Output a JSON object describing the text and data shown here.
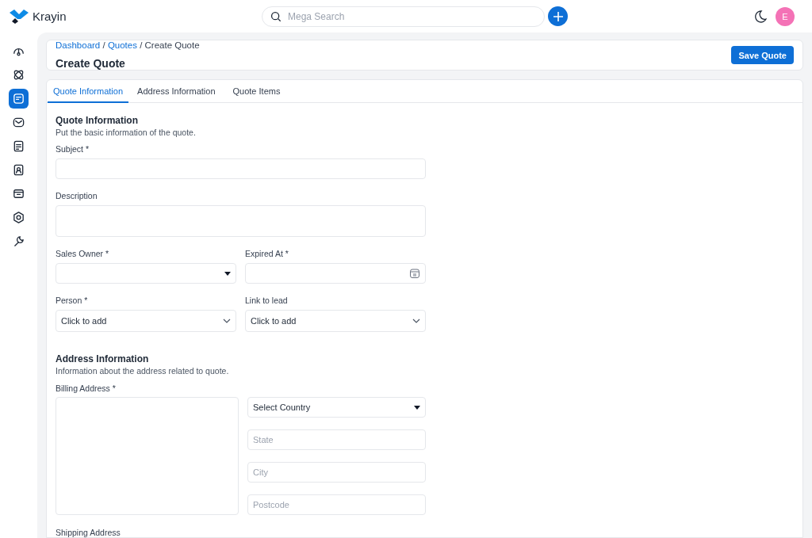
{
  "header": {
    "logo": "Krayin",
    "search": {
      "placeholder": "Mega Search"
    },
    "avatar": "E"
  },
  "sidebar": {
    "items": [
      {
        "selected": false
      },
      {
        "selected": false
      },
      {
        "selected": true
      },
      {
        "selected": false
      },
      {
        "selected": false
      },
      {
        "selected": false
      },
      {
        "selected": false
      },
      {
        "selected": false
      },
      {
        "selected": false
      }
    ]
  },
  "page": {
    "breadcrumb_separator": "/",
    "breadcrumb": [
      {
        "label": "Dashboard",
        "link": true
      },
      {
        "label": "Quotes",
        "link": true
      },
      {
        "label": "Create Quote",
        "link": false
      }
    ],
    "title": "Create Quote",
    "save_button": "Save Quote"
  },
  "tabs": [
    {
      "label": "Quote Information",
      "selected": true
    },
    {
      "label": "Address Information",
      "selected": false
    },
    {
      "label": "Quote Items",
      "selected": false
    }
  ],
  "sections": [
    {
      "title": "Quote Information",
      "subtitle": "Put the basic information of the quote.",
      "rows": [
        [
          {
            "label": "Subject *",
            "kind": "text"
          }
        ],
        [
          {
            "label": "Description",
            "kind": "textarea"
          }
        ],
        [
          {
            "label": "Sales Owner *",
            "kind": "select"
          },
          {
            "label": "Expired At *",
            "kind": "date"
          }
        ],
        [
          {
            "label": "Person *",
            "kind": "lookup",
            "value": "Click to add"
          },
          {
            "label": "Link to lead",
            "kind": "lookup",
            "value": "Click to add"
          }
        ]
      ]
    },
    {
      "title": "Address Information",
      "subtitle": "Information about the address related to quote.",
      "address": {
        "label": "Billing Address *",
        "fields": [
          {
            "kind": "select",
            "value": "Select Country"
          },
          {
            "kind": "text",
            "placeholder": "State"
          },
          {
            "kind": "text",
            "placeholder": "City"
          },
          {
            "kind": "text",
            "placeholder": "Postcode"
          }
        ]
      },
      "next_label": "Shipping Address"
    }
  ]
}
